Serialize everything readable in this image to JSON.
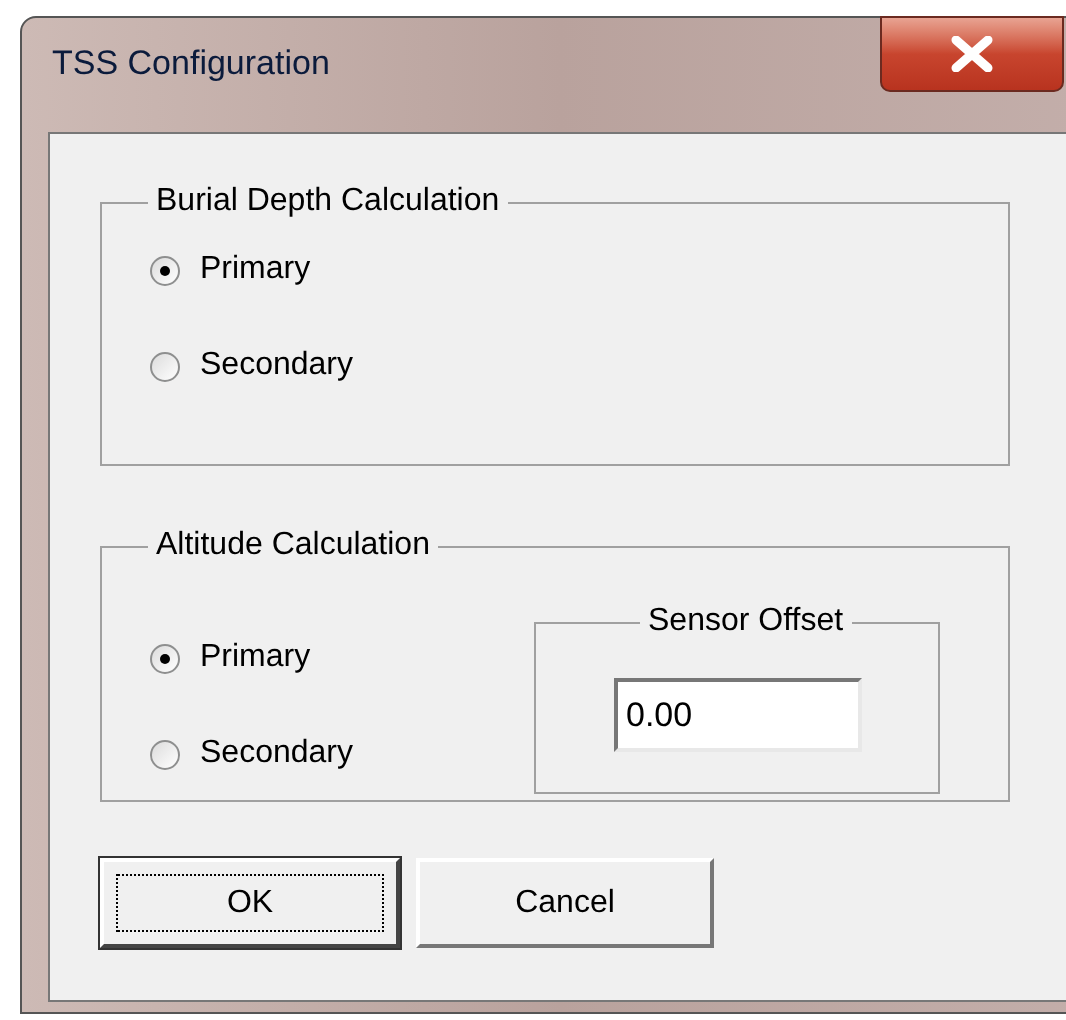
{
  "window": {
    "title": "TSS Configuration"
  },
  "burial_depth": {
    "title": "Burial Depth Calculation",
    "options": [
      {
        "label": "Primary",
        "selected": true
      },
      {
        "label": "Secondary",
        "selected": false
      }
    ]
  },
  "altitude": {
    "title": "Altitude Calculation",
    "options": [
      {
        "label": "Primary",
        "selected": true
      },
      {
        "label": "Secondary",
        "selected": false
      }
    ],
    "sensor_offset": {
      "title": "Sensor Offset",
      "value": "0.00"
    }
  },
  "buttons": [
    {
      "label": "OK",
      "default": true
    },
    {
      "label": "Cancel",
      "default": false
    }
  ]
}
